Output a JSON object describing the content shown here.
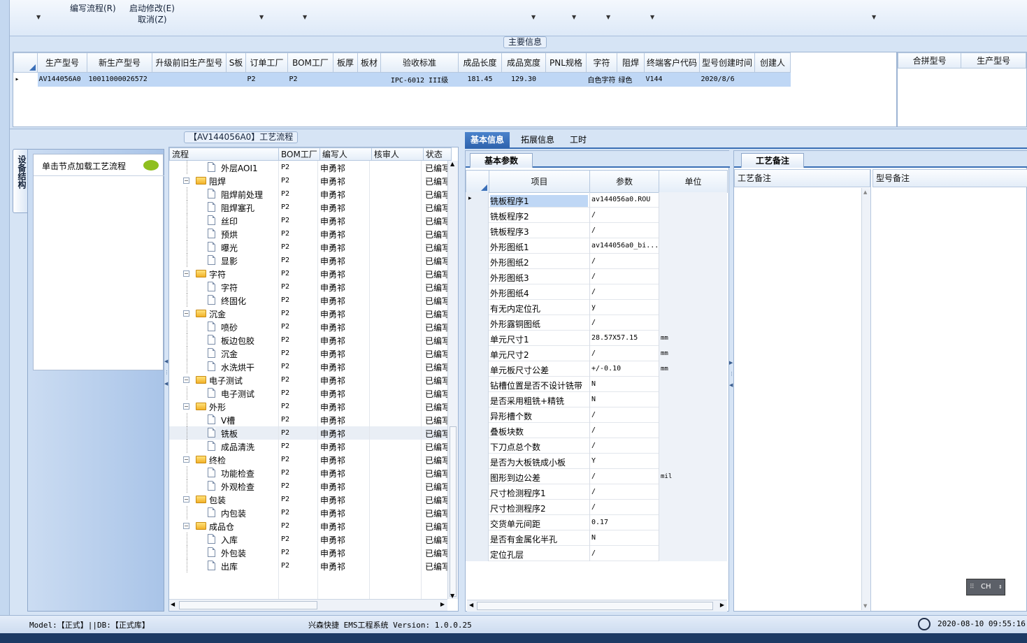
{
  "ribbon": {
    "write_flow": "编写流程(R)",
    "start_modify": "启动修改(E)",
    "cancel": "取消(Z)"
  },
  "main_info": {
    "title": "主要信息",
    "columns": [
      "生产型号",
      "新生产型号",
      "升级前旧生产型号",
      "S板",
      "订单工厂",
      "BOM工厂",
      "板厚",
      "板材",
      "验收标准",
      "成品长度",
      "成品宽度",
      "PNL规格",
      "字符",
      "阻焊",
      "终端客户代码",
      "型号创建时间",
      "创建人"
    ],
    "rows": [
      [
        "AV144056A0",
        "10011000026572",
        "",
        "",
        "P2",
        "P2",
        "",
        "",
        "IPC-6012 III级",
        "181.45",
        "129.30",
        "",
        "白色字符",
        "绿色",
        "V144",
        "2020/8/6",
        ""
      ]
    ],
    "side_columns": [
      "合拼型号",
      "生产型号"
    ]
  },
  "process": {
    "title": "【AV144056A0】工艺流程",
    "vertical_tab": "设备结构",
    "hint": "单击节点加载工艺流程",
    "columns": [
      "流程",
      "BOM工厂",
      "编写人",
      "核审人",
      "状态"
    ],
    "items": [
      {
        "name": "外层AOI1",
        "level": 1,
        "bom": "P2",
        "writer": "申勇祁",
        "status": "已编写"
      },
      {
        "name": "阻焊",
        "level": 0,
        "bom": "P2",
        "writer": "申勇祁",
        "status": "已编写"
      },
      {
        "name": "阻焊前处理",
        "level": 1,
        "bom": "P2",
        "writer": "申勇祁",
        "status": "已编写"
      },
      {
        "name": "阻焊塞孔",
        "level": 1,
        "bom": "P2",
        "writer": "申勇祁",
        "status": "已编写"
      },
      {
        "name": "丝印",
        "level": 1,
        "bom": "P2",
        "writer": "申勇祁",
        "status": "已编写"
      },
      {
        "name": "预烘",
        "level": 1,
        "bom": "P2",
        "writer": "申勇祁",
        "status": "已编写"
      },
      {
        "name": "曝光",
        "level": 1,
        "bom": "P2",
        "writer": "申勇祁",
        "status": "已编写"
      },
      {
        "name": "显影",
        "level": 1,
        "bom": "P2",
        "writer": "申勇祁",
        "status": "已编写"
      },
      {
        "name": "字符",
        "level": 0,
        "bom": "P2",
        "writer": "申勇祁",
        "status": "已编写"
      },
      {
        "name": "字符",
        "level": 1,
        "bom": "P2",
        "writer": "申勇祁",
        "status": "已编写"
      },
      {
        "name": "终固化",
        "level": 1,
        "bom": "P2",
        "writer": "申勇祁",
        "status": "已编写"
      },
      {
        "name": "沉金",
        "level": 0,
        "bom": "P2",
        "writer": "申勇祁",
        "status": "已编写"
      },
      {
        "name": "喷砂",
        "level": 1,
        "bom": "P2",
        "writer": "申勇祁",
        "status": "已编写"
      },
      {
        "name": "板边包胶",
        "level": 1,
        "bom": "P2",
        "writer": "申勇祁",
        "status": "已编写"
      },
      {
        "name": "沉金",
        "level": 1,
        "bom": "P2",
        "writer": "申勇祁",
        "status": "已编写"
      },
      {
        "name": "水洗烘干",
        "level": 1,
        "bom": "P2",
        "writer": "申勇祁",
        "status": "已编写"
      },
      {
        "name": "电子测试",
        "level": 0,
        "bom": "P2",
        "writer": "申勇祁",
        "status": "已编写"
      },
      {
        "name": "电子测试",
        "level": 1,
        "bom": "P2",
        "writer": "申勇祁",
        "status": "已编写"
      },
      {
        "name": "外形",
        "level": 0,
        "bom": "P2",
        "writer": "申勇祁",
        "status": "已编写"
      },
      {
        "name": "V槽",
        "level": 1,
        "bom": "P2",
        "writer": "申勇祁",
        "status": "已编写"
      },
      {
        "name": "铣板",
        "level": 1,
        "bom": "P2",
        "writer": "申勇祁",
        "status": "已编写",
        "selected": true
      },
      {
        "name": "成品清洗",
        "level": 1,
        "bom": "P2",
        "writer": "申勇祁",
        "status": "已编写"
      },
      {
        "name": "终检",
        "level": 0,
        "bom": "P2",
        "writer": "申勇祁",
        "status": "已编写"
      },
      {
        "name": "功能检查",
        "level": 1,
        "bom": "P2",
        "writer": "申勇祁",
        "status": "已编写"
      },
      {
        "name": "外观检查",
        "level": 1,
        "bom": "P2",
        "writer": "申勇祁",
        "status": "已编写"
      },
      {
        "name": "包装",
        "level": 0,
        "bom": "P2",
        "writer": "申勇祁",
        "status": "已编写"
      },
      {
        "name": "内包装",
        "level": 1,
        "bom": "P2",
        "writer": "申勇祁",
        "status": "已编写"
      },
      {
        "name": "成品仓",
        "level": 0,
        "bom": "P2",
        "writer": "申勇祁",
        "status": "已编写"
      },
      {
        "name": "入库",
        "level": 1,
        "bom": "P2",
        "writer": "申勇祁",
        "status": "已编写"
      },
      {
        "name": "外包装",
        "level": 1,
        "bom": "P2",
        "writer": "申勇祁",
        "status": "已编写"
      },
      {
        "name": "出库",
        "level": 1,
        "bom": "P2",
        "writer": "申勇祁",
        "status": "已编写"
      }
    ]
  },
  "tabs": [
    "基本信息",
    "拓展信息",
    "工时"
  ],
  "basic_params": {
    "title": "基本参数",
    "columns": [
      "项目",
      "参数",
      "单位"
    ],
    "rows": [
      {
        "item": "铣板程序1",
        "value": "av144056a0.ROU",
        "unit": ""
      },
      {
        "item": "铣板程序2",
        "value": "/",
        "unit": ""
      },
      {
        "item": "铣板程序3",
        "value": "/",
        "unit": ""
      },
      {
        "item": "外形图纸1",
        "value": "av144056a0_bi...",
        "unit": ""
      },
      {
        "item": "外形图纸2",
        "value": "/",
        "unit": ""
      },
      {
        "item": "外形图纸3",
        "value": "/",
        "unit": ""
      },
      {
        "item": "外形图纸4",
        "value": "/",
        "unit": ""
      },
      {
        "item": "有无内定位孔",
        "value": "y",
        "unit": ""
      },
      {
        "item": "外形露铜图纸",
        "value": "/",
        "unit": ""
      },
      {
        "item": "单元尺寸1",
        "value": "28.57X57.15",
        "unit": "mm"
      },
      {
        "item": "单元尺寸2",
        "value": "/",
        "unit": "mm"
      },
      {
        "item": "单元板尺寸公差",
        "value": "+/-0.10",
        "unit": "mm"
      },
      {
        "item": "钻槽位置是否不设计铣带",
        "value": "N",
        "unit": ""
      },
      {
        "item": "是否采用粗铣+精铣",
        "value": "N",
        "unit": ""
      },
      {
        "item": "异形槽个数",
        "value": "/",
        "unit": ""
      },
      {
        "item": "叠板块数",
        "value": "/",
        "unit": ""
      },
      {
        "item": "下刀点总个数",
        "value": "/",
        "unit": ""
      },
      {
        "item": "是否为大板铣成小板",
        "value": "Y",
        "unit": ""
      },
      {
        "item": "图形到边公差",
        "value": "/",
        "unit": "mil"
      },
      {
        "item": "尺寸检测程序1",
        "value": "/",
        "unit": ""
      },
      {
        "item": "尺寸检测程序2",
        "value": "/",
        "unit": ""
      },
      {
        "item": "交货单元间距",
        "value": "0.17",
        "unit": ""
      },
      {
        "item": "是否有金属化半孔",
        "value": "N",
        "unit": ""
      },
      {
        "item": "定位孔层",
        "value": "/",
        "unit": ""
      }
    ]
  },
  "remarks": {
    "tab": "工艺备注",
    "process_remark": "工艺备注",
    "model_remark": "型号备注"
  },
  "ime": "CH",
  "status": {
    "model": "Model:【正式】||DB:【正式库】",
    "app": "兴森快捷 EMS工程系统 Version: 1.0.0.25",
    "time": "2020-08-10 09:55:16"
  }
}
